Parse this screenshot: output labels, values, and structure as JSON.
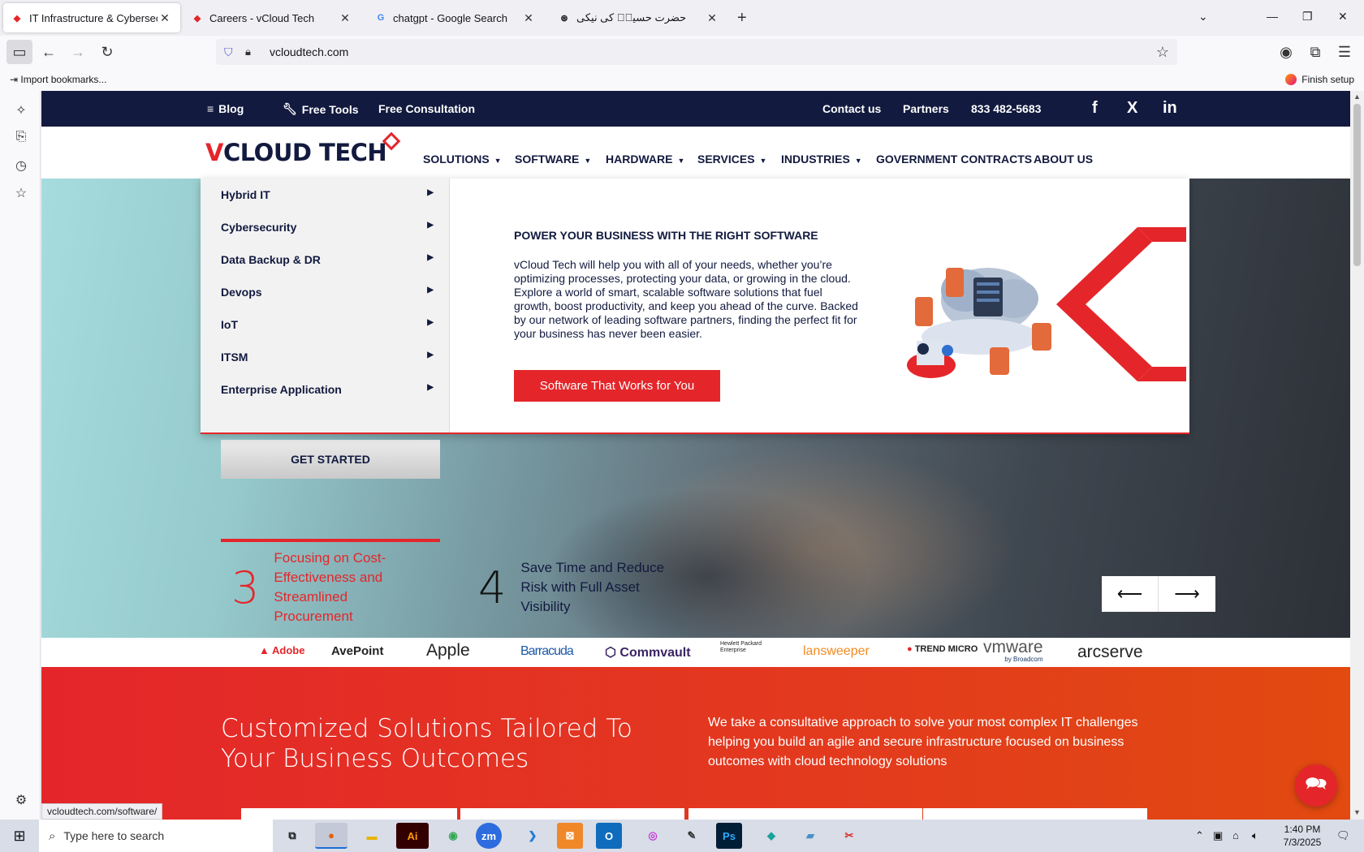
{
  "browser": {
    "tabs": [
      {
        "title": "IT Infrastructure & Cybersecurit",
        "active": true
      },
      {
        "title": "Careers - vCloud Tech",
        "active": false
      },
      {
        "title": "chatgpt - Google Search",
        "active": false
      },
      {
        "title": "حضرت حسینؓ کی نیکی",
        "active": false
      }
    ],
    "url": "vcloudtech.com",
    "bookmarks_import": "Import bookmarks...",
    "finish_setup": "Finish setup",
    "status_url": "vcloudtech.com/software/"
  },
  "site": {
    "top": {
      "blog": "Blog",
      "free_tools": "Free Tools",
      "free_consultation": "Free Consultation",
      "contact": "Contact us",
      "partners": "Partners",
      "phone": "833 482-5683",
      "facebook": "f",
      "x": "X",
      "linkedin": "in"
    },
    "logo": {
      "v": "V",
      "rest": "CLOUD TECH"
    },
    "nav": [
      "SOLUTIONS",
      "SOFTWARE",
      "HARDWARE",
      "SERVICES",
      "INDUSTRIES",
      "GOVERNMENT CONTRACTS",
      "ABOUT US"
    ],
    "mega": {
      "items": [
        "Hybrid IT",
        "Cybersecurity",
        "Data Backup & DR",
        "Devops",
        "IoT",
        "ITSM",
        "Enterprise Application"
      ],
      "title": "POWER YOUR BUSINESS WITH THE RIGHT SOFTWARE",
      "text": "vCloud Tech will help you with all of your needs, whether you’re optimizing processes, protecting your data, or growing in the cloud. Explore a world of smart, scalable software solutions that fuel growth, boost productivity, and keep you ahead of the curve. Backed by our network of leading software partners, finding the perfect fit for your business has never been easier.",
      "button": "Software That Works for You"
    },
    "hero": {
      "cta": "GET STARTED",
      "stat1_num": "3",
      "stat1_text": "Focusing on Cost-Effectiveness and Streamlined Procurement",
      "stat2_num": "4",
      "stat2_text": "Save Time and Reduce Risk with Full Asset Visibility"
    },
    "brands": [
      "Adobe",
      "AvePoint",
      "Apple",
      "Barracuda",
      "Commvault",
      "Hewlett Packard Enterprise",
      "lansweeper",
      "TREND MICRO",
      "vmware",
      "by Broadcom",
      "arcserve"
    ],
    "solutions": {
      "heading": "Customized Solutions Tailored To Your Business Outcomes",
      "text": "We take a consultative approach to solve your most complex IT challenges helping you build an agile and secure infrastructure focused on business outcomes with cloud technology solutions"
    }
  },
  "taskbar": {
    "search_placeholder": "Type here to search",
    "time": "1:40 PM",
    "date": "7/3/2025"
  }
}
